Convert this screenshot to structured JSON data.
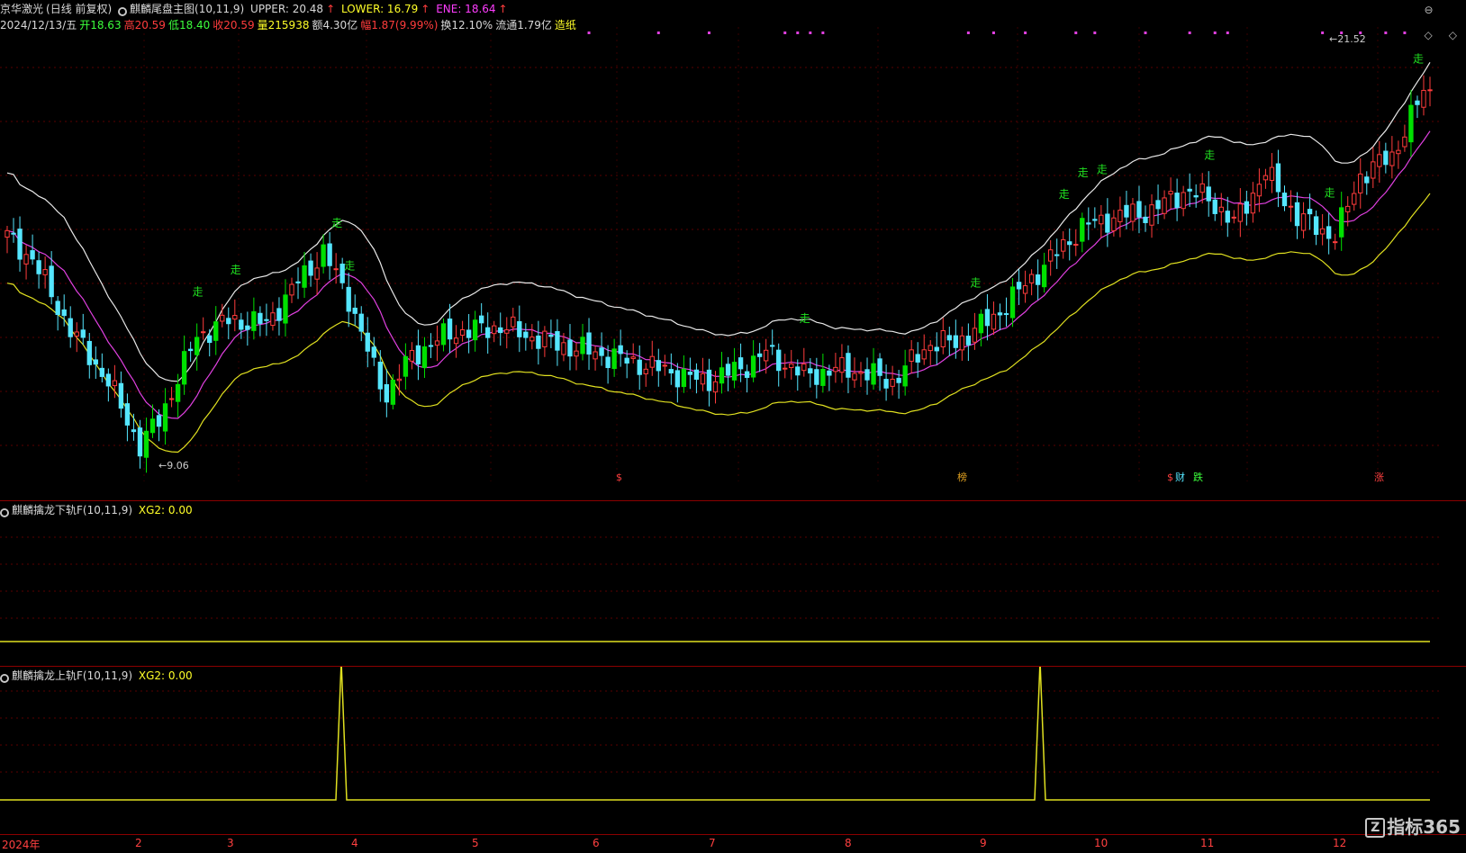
{
  "main": {
    "stock": "京华激光",
    "mode": "(日线 前复权)",
    "indicator": "麒麟尾盘主图(10,11,9)",
    "upper": "UPPER: 20.48",
    "lower": "LOWER: 16.79",
    "ene": "ENE: 18.64",
    "date": "2024/12/13/五",
    "open": "开18.63",
    "high": "高20.59",
    "low": "低18.40",
    "close": "收20.59",
    "vol": "量215938",
    "amount": "额4.30亿",
    "change": "幅1.87(9.99%)",
    "turnover": "换12.10%",
    "float": "流通1.79亿",
    "tag": "造纸",
    "max_label": "21.52",
    "min_label": "9.06",
    "signal_label": "走",
    "events": [
      "$",
      "榜",
      "$",
      "财",
      "跌",
      "涨"
    ]
  },
  "sub1": {
    "title": "麒麟擒龙下轨F(10,11,9)",
    "value": "XG2: 0.00"
  },
  "sub2": {
    "title": "麒麟擒龙上轨F(10,11,9)",
    "value": "XG2: 0.00"
  },
  "xaxis": [
    "2024年",
    "2",
    "3",
    "4",
    "5",
    "6",
    "7",
    "8",
    "9",
    "10",
    "11",
    "12"
  ],
  "logo": {
    "text": "指标365",
    "mark": "Z"
  },
  "colors": {
    "up": "#ff3c3c",
    "down": "#55e6ff",
    "signal": "#00e000",
    "upper": "#e8e8e8",
    "mid": "#e040e0",
    "lower": "#e0e020"
  },
  "chart_data": {
    "type": "candlestick",
    "price_range": [
      8.5,
      22.6
    ],
    "ticks": {
      "x_labels": [
        "2024年",
        "2",
        "3",
        "4",
        "5",
        "6",
        "7",
        "8",
        "9",
        "10",
        "11",
        "12"
      ]
    },
    "anchors": [
      [
        0,
        16.1
      ],
      [
        4,
        15.4
      ],
      [
        10,
        13.2
      ],
      [
        16,
        11.6
      ],
      [
        21,
        9.6
      ],
      [
        24,
        10.4
      ],
      [
        30,
        13.0
      ],
      [
        35,
        13.5
      ],
      [
        41,
        13.4
      ],
      [
        46,
        14.7
      ],
      [
        50,
        15.6
      ],
      [
        54,
        14.2
      ],
      [
        58,
        12.0
      ],
      [
        60,
        11.2
      ],
      [
        64,
        12.4
      ],
      [
        70,
        13.1
      ],
      [
        78,
        13.3
      ],
      [
        86,
        12.8
      ],
      [
        95,
        12.4
      ],
      [
        105,
        11.9
      ],
      [
        110,
        11.6
      ],
      [
        116,
        12.0
      ],
      [
        120,
        12.5
      ],
      [
        126,
        11.8
      ],
      [
        133,
        12.0
      ],
      [
        140,
        11.6
      ],
      [
        146,
        12.8
      ],
      [
        150,
        12.8
      ],
      [
        156,
        13.6
      ],
      [
        164,
        15.2
      ],
      [
        170,
        16.4
      ],
      [
        175,
        16.7
      ],
      [
        181,
        16.9
      ],
      [
        186,
        17.5
      ],
      [
        190,
        17.3
      ],
      [
        194,
        16.5
      ],
      [
        199,
        18.1
      ],
      [
        204,
        16.7
      ],
      [
        210,
        16.1
      ],
      [
        214,
        18.0
      ],
      [
        219,
        18.6
      ],
      [
        224,
        20.6
      ]
    ],
    "xg2_lower": [],
    "xg2_upper_spikes": [
      52,
      155
    ]
  }
}
